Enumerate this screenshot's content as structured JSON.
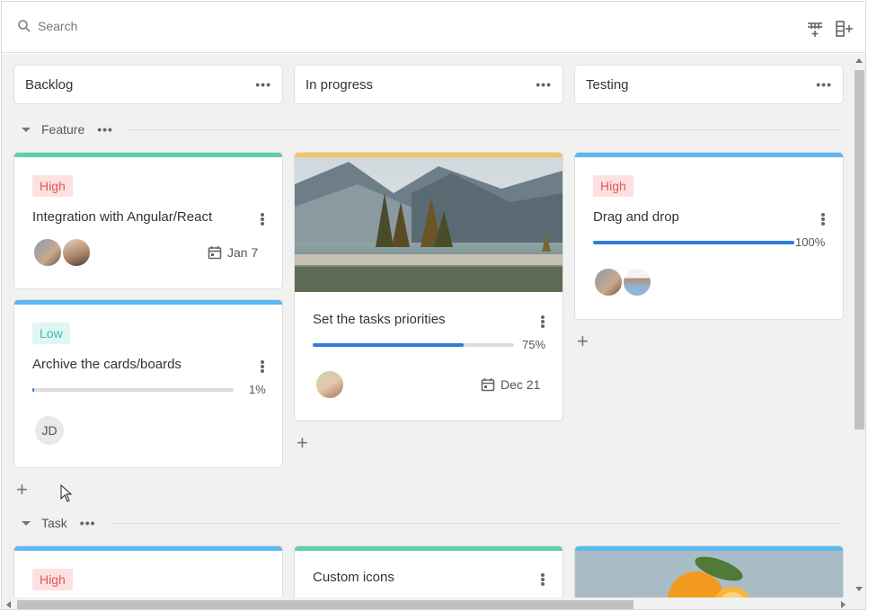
{
  "search": {
    "placeholder": "Search"
  },
  "toolbar": {
    "add_column_icon": "add-column-icon",
    "add_row_icon": "add-row-icon"
  },
  "columns": [
    {
      "label": "Backlog"
    },
    {
      "label": "In progress"
    },
    {
      "label": "Testing"
    }
  ],
  "rows": [
    {
      "label": "Feature"
    },
    {
      "label": "Task"
    }
  ],
  "cards": {
    "c1": {
      "priority": "High",
      "title": "Integration with Angular/React",
      "date": "Jan 7",
      "accent": "#5fcfaa"
    },
    "c2": {
      "priority": "Low",
      "title": "Archive the cards/boards",
      "progress": 1,
      "progress_label": "1%",
      "initials": "JD",
      "accent": "#5db8f2"
    },
    "c3": {
      "title": "Set the tasks priorities",
      "progress": 75,
      "progress_label": "75%",
      "date": "Dec 21",
      "accent": "#f6c361"
    },
    "c4": {
      "priority": "High",
      "title": "Drag and drop",
      "progress": 100,
      "progress_label": "100%",
      "accent": "#5db8f2"
    },
    "c5": {
      "priority": "High",
      "accent": "#5db8f2"
    },
    "c6": {
      "title": "Custom icons",
      "accent": "#5fcfaa"
    },
    "c7": {
      "accent": "#5db8f2"
    }
  },
  "colors": {
    "accent": "#2f7de1",
    "high_bg": "#fde1e1",
    "high_fg": "#e45555",
    "low_bg": "#dff6f3",
    "low_fg": "#3cbeae"
  }
}
